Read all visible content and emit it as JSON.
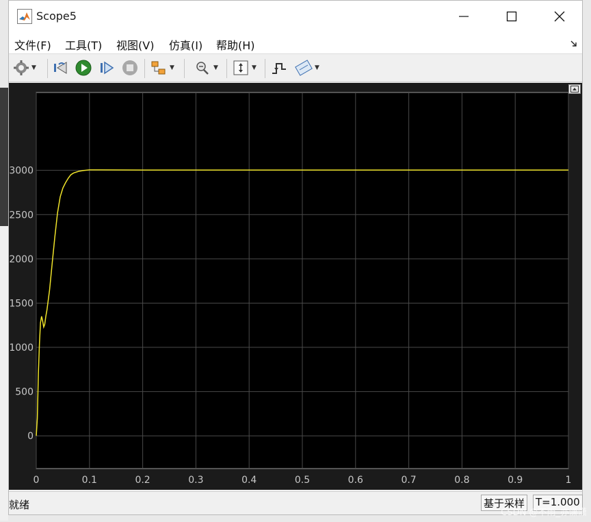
{
  "window": {
    "title": "Scope5"
  },
  "menu": {
    "items": [
      "文件(F)",
      "工具(T)",
      "视图(V)",
      "仿真(I)",
      "帮助(H)"
    ]
  },
  "toolbar": {
    "buttons": [
      {
        "name": "settings-icon"
      },
      {
        "name": "step-back-icon"
      },
      {
        "name": "run-icon"
      },
      {
        "name": "step-forward-icon"
      },
      {
        "name": "stop-icon"
      },
      {
        "name": "highlight-block-icon"
      },
      {
        "name": "zoom-icon"
      },
      {
        "name": "autoscale-icon"
      },
      {
        "name": "trigger-icon"
      },
      {
        "name": "measure-icon"
      }
    ]
  },
  "chart_data": {
    "type": "line",
    "title": "",
    "xlabel": "",
    "ylabel": "",
    "xlim": [
      0,
      1
    ],
    "ylim": [
      -370,
      3880
    ],
    "xticks": [
      0,
      0.1,
      0.2,
      0.3,
      0.4,
      0.5,
      0.6,
      0.7,
      0.8,
      0.9,
      1
    ],
    "xtick_labels": [
      "0",
      "0.1",
      "0.2",
      "0.3",
      "0.4",
      "0.5",
      "0.6",
      "0.7",
      "0.8",
      "0.9",
      "1"
    ],
    "yticks": [
      0,
      500,
      1000,
      1500,
      2000,
      2500,
      3000
    ],
    "ytick_labels": [
      "0",
      "500",
      "1000",
      "1500",
      "2000",
      "2500",
      "3000"
    ],
    "grid": true,
    "background": "#000000",
    "line_color": "#f0e42a",
    "series": [
      {
        "points": [
          [
            0,
            0
          ],
          [
            0.002,
            200
          ],
          [
            0.004,
            700
          ],
          [
            0.006,
            1050
          ],
          [
            0.008,
            1280
          ],
          [
            0.01,
            1350
          ],
          [
            0.012,
            1300
          ],
          [
            0.014,
            1230
          ],
          [
            0.016,
            1260
          ],
          [
            0.018,
            1350
          ],
          [
            0.02,
            1420
          ],
          [
            0.025,
            1650
          ],
          [
            0.03,
            1950
          ],
          [
            0.035,
            2250
          ],
          [
            0.04,
            2520
          ],
          [
            0.045,
            2700
          ],
          [
            0.05,
            2800
          ],
          [
            0.055,
            2860
          ],
          [
            0.06,
            2910
          ],
          [
            0.065,
            2950
          ],
          [
            0.07,
            2970
          ],
          [
            0.08,
            2990
          ],
          [
            0.09,
            3000
          ],
          [
            0.1,
            3005
          ],
          [
            0.12,
            3005
          ],
          [
            0.2,
            3004
          ],
          [
            0.3,
            3004
          ],
          [
            0.4,
            3004
          ],
          [
            0.5,
            3004
          ],
          [
            0.6,
            3004
          ],
          [
            0.7,
            3004
          ],
          [
            0.8,
            3004
          ],
          [
            0.9,
            3004
          ],
          [
            1.0,
            3004
          ]
        ]
      }
    ]
  },
  "status": {
    "state": "就绪",
    "mode": "基于采样",
    "time": "T=1.000"
  },
  "watermark": "CSDN @不雨_亦潇潇"
}
